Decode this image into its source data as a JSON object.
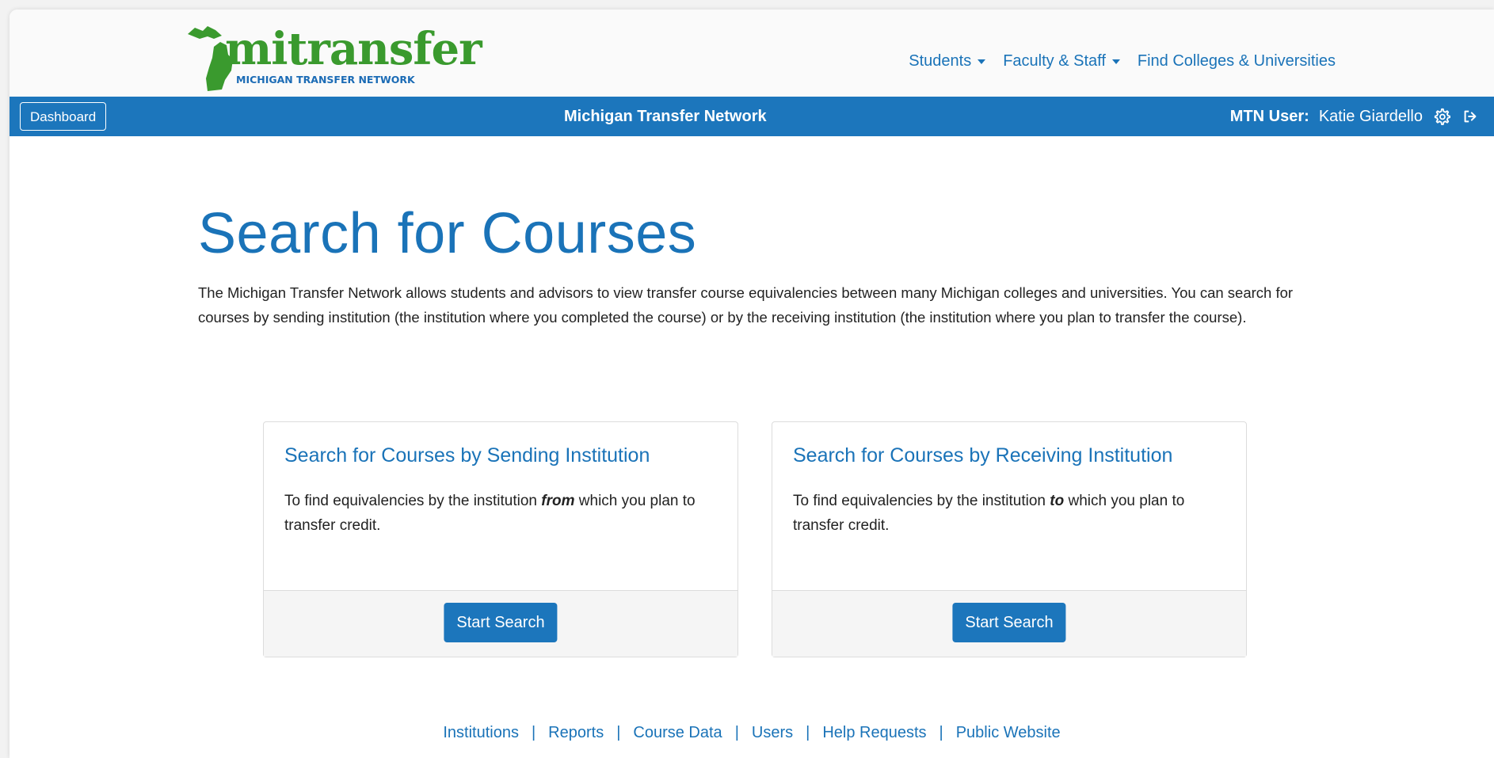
{
  "logo": {
    "wordmark": "mitransfer",
    "subtitle": "MICHIGAN TRANSFER NETWORK",
    "icon": "michigan-map-icon"
  },
  "nav": {
    "students": "Students",
    "faculty": "Faculty & Staff",
    "find": "Find Colleges & Universities"
  },
  "bar": {
    "dashboard": "Dashboard",
    "title": "Michigan Transfer Network",
    "user_label": "MTN User:",
    "user_name": "Katie Giardello",
    "settings_icon": "gear-icon",
    "logout_icon": "sign-out-icon"
  },
  "main": {
    "title": "Search for Courses",
    "intro": "The Michigan Transfer Network allows students and advisors to view transfer course equivalencies between many Michigan colleges and universities.  You can search for courses by sending institution (the institution where you completed the course) or by the receiving institution (the institution where you plan to transfer the course)."
  },
  "cards": {
    "sending": {
      "title": "Search for Courses by Sending Institution",
      "text_before": "To find equivalencies by the institution ",
      "emphasis": "from",
      "text_after": " which you plan to transfer credit.",
      "button": "Start Search"
    },
    "receiving": {
      "title": "Search for Courses by Receiving Institution",
      "text_before": "To find equivalencies by the institution ",
      "emphasis": "to",
      "text_after": " which you plan to transfer credit.",
      "button": "Start Search"
    }
  },
  "footer": {
    "links": [
      "Institutions",
      "Reports",
      "Course Data",
      "Users",
      "Help Requests",
      "Public Website"
    ],
    "separator": "|"
  },
  "colors": {
    "primary": "#1c76bc",
    "link": "#1a73b8",
    "logo_green": "#3a9a2e"
  }
}
